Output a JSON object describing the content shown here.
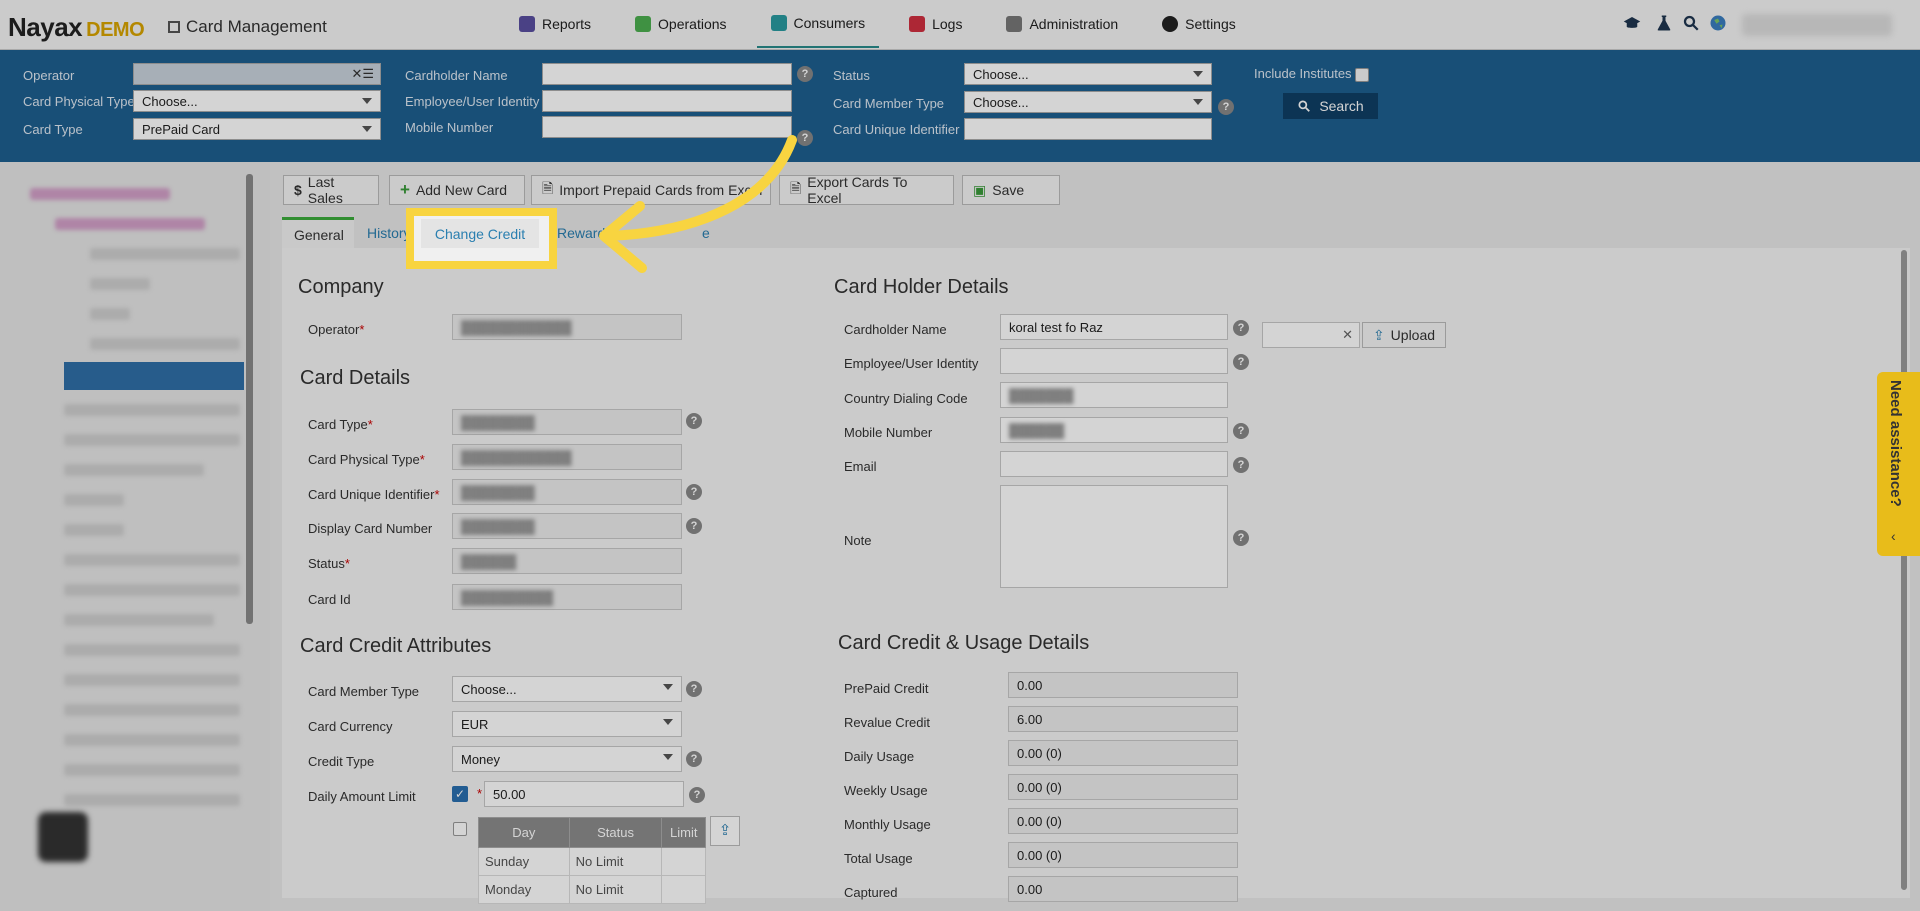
{
  "brand": {
    "name": "Nayax",
    "tag": "DEMO"
  },
  "page_title": "Card Management",
  "menu": [
    {
      "label": "Reports",
      "icon": "reports-icon",
      "color": "#5a4fa0"
    },
    {
      "label": "Operations",
      "icon": "operations-icon",
      "color": "#4caf50"
    },
    {
      "label": "Consumers",
      "icon": "consumers-icon",
      "color": "#2a9aa0",
      "active": true
    },
    {
      "label": "Logs",
      "icon": "logs-icon",
      "color": "#d03040"
    },
    {
      "label": "Administration",
      "icon": "administration-icon",
      "color": "#777"
    },
    {
      "label": "Settings",
      "icon": "settings-icon",
      "color": "#222"
    }
  ],
  "filters": {
    "operator_label": "Operator",
    "card_physical_type_label": "Card Physical Type",
    "card_physical_type_value": "Choose...",
    "card_type_label": "Card Type",
    "card_type_value": "PrePaid Card",
    "cardholder_name_label": "Cardholder Name",
    "employee_identity_label": "Employee/User Identity",
    "mobile_number_label": "Mobile Number",
    "status_label": "Status",
    "status_value": "Choose...",
    "card_member_type_label": "Card Member Type",
    "card_member_type_value": "Choose...",
    "card_unique_identifier_label": "Card Unique Identifier",
    "include_institutes_label": "Include Institutes",
    "search_label": "Search"
  },
  "toolbar": {
    "last_sales": "Last Sales",
    "add_new_card": "Add New Card",
    "import_prepaid": "Import Prepaid Cards from Excel",
    "export_cards": "Export Cards To Excel",
    "save": "Save"
  },
  "tabs": {
    "general": "General",
    "history": "History",
    "change_credit": "Change Credit",
    "reward": "Reward",
    "tail": "e"
  },
  "company": {
    "heading": "Company",
    "operator_label": "Operator"
  },
  "card_details": {
    "heading": "Card Details",
    "card_type": "Card Type",
    "card_physical_type": "Card Physical Type",
    "card_unique_identifier": "Card Unique Identifier",
    "display_card_number": "Display Card Number",
    "status": "Status",
    "card_id": "Card Id"
  },
  "credit_attrs": {
    "heading": "Card Credit Attributes",
    "member_type_label": "Card Member Type",
    "member_type_value": "Choose...",
    "currency_label": "Card Currency",
    "currency_value": "EUR",
    "credit_type_label": "Credit Type",
    "credit_type_value": "Money",
    "daily_limit_label": "Daily Amount Limit",
    "daily_limit_value": "50.00",
    "table_headers": [
      "Day",
      "Status",
      "Limit"
    ],
    "table_rows": [
      [
        "Sunday",
        "No Limit",
        ""
      ],
      [
        "Monday",
        "No Limit",
        ""
      ]
    ]
  },
  "holder": {
    "heading": "Card Holder Details",
    "cardholder_name_label": "Cardholder Name",
    "cardholder_name_value": "koral test fo Raz",
    "employee_label": "Employee/User Identity",
    "country_code_label": "Country Dialing Code",
    "mobile_label": "Mobile Number",
    "email_label": "Email",
    "note_label": "Note",
    "upload_label": "Upload"
  },
  "usage": {
    "heading": "Card Credit & Usage Details",
    "rows": [
      {
        "label": "PrePaid Credit",
        "value": "0.00"
      },
      {
        "label": "Revalue Credit",
        "value": "6.00"
      },
      {
        "label": "Daily Usage",
        "value": "0.00 (0)"
      },
      {
        "label": "Weekly Usage",
        "value": "0.00 (0)"
      },
      {
        "label": "Monthly Usage",
        "value": "0.00 (0)"
      },
      {
        "label": "Total Usage",
        "value": "0.00 (0)"
      },
      {
        "label": "Captured",
        "value": "0.00"
      }
    ]
  },
  "assistance": "Need assistance?",
  "colors": {
    "filter_bar": "#1e5f90",
    "highlight": "#f8d440",
    "active_tab": "#3cab3c"
  }
}
